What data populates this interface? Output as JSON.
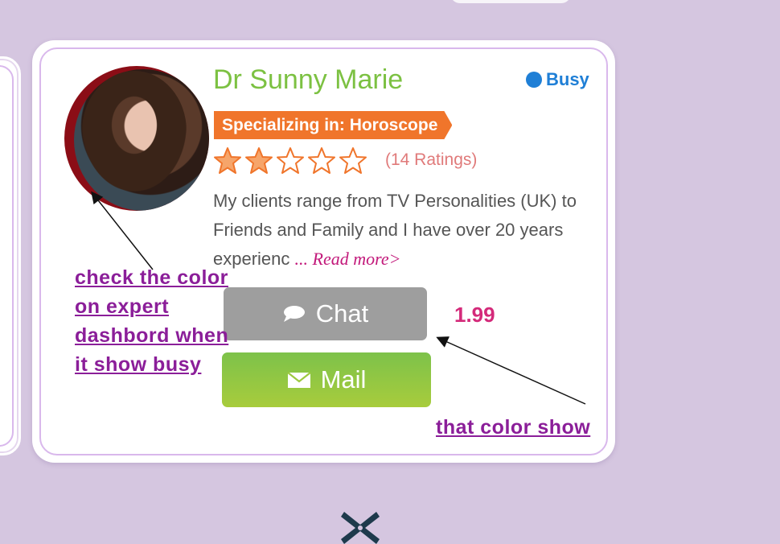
{
  "expert": {
    "name": "Dr Sunny Marie",
    "status": "Busy",
    "specialty": "Specializing in: Horoscope",
    "rating": 2,
    "rating_max": 5,
    "ratings_text": "(14 Ratings)",
    "bio": "My clients range from TV Personalities (UK) to Friends and Family and I have over 20 years experienc",
    "read_more": "... Read more>",
    "price": "1.99"
  },
  "buttons": {
    "chat": "Chat",
    "mail": "Mail"
  },
  "annotations": {
    "left": "check the color on expert dashbord when it show busy",
    "right": "that color show"
  },
  "colors": {
    "name": "#7cc142",
    "status": "#1f7fd6",
    "specialty_bg": "#f0752b",
    "chat_bg": "#9e9e9e",
    "mail_bg": "#8cc63f",
    "price": "#d42a7a",
    "annotation": "#8b1e99"
  },
  "icons": {
    "chat": "chat-bubble-icon",
    "mail": "envelope-icon",
    "status": "status-dot-icon",
    "bottom": "close-x-icon"
  }
}
